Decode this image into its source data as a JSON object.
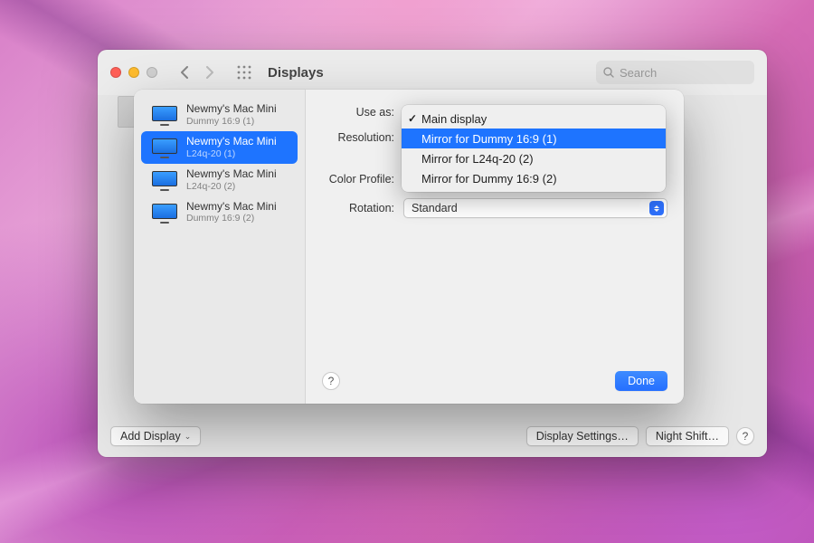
{
  "toolbar": {
    "title": "Displays",
    "search_placeholder": "Search"
  },
  "bottom": {
    "add_display": "Add Display",
    "display_settings": "Display Settings…",
    "night_shift": "Night Shift…"
  },
  "sidebar": {
    "items": [
      {
        "name": "Newmy's Mac Mini",
        "sub": "Dummy 16:9 (1)"
      },
      {
        "name": "Newmy's Mac Mini",
        "sub": "L24q-20 (1)"
      },
      {
        "name": "Newmy's Mac Mini",
        "sub": "L24q-20 (2)"
      },
      {
        "name": "Newmy's Mac Mini",
        "sub": "Dummy 16:9 (2)"
      }
    ],
    "selected_index": 1
  },
  "form": {
    "use_as_label": "Use as:",
    "resolution_label": "Resolution:",
    "color_profile_label": "Color Profile:",
    "rotation_label": "Rotation:",
    "rotation_value": "Standard"
  },
  "dropdown": {
    "items": [
      {
        "label": "Main display",
        "checked": true
      },
      {
        "label": "Mirror for Dummy 16:9 (1)",
        "checked": false
      },
      {
        "label": "Mirror for L24q-20 (2)",
        "checked": false
      },
      {
        "label": "Mirror for Dummy 16:9 (2)",
        "checked": false
      }
    ],
    "highlighted_index": 1
  },
  "buttons": {
    "done": "Done",
    "help": "?"
  }
}
